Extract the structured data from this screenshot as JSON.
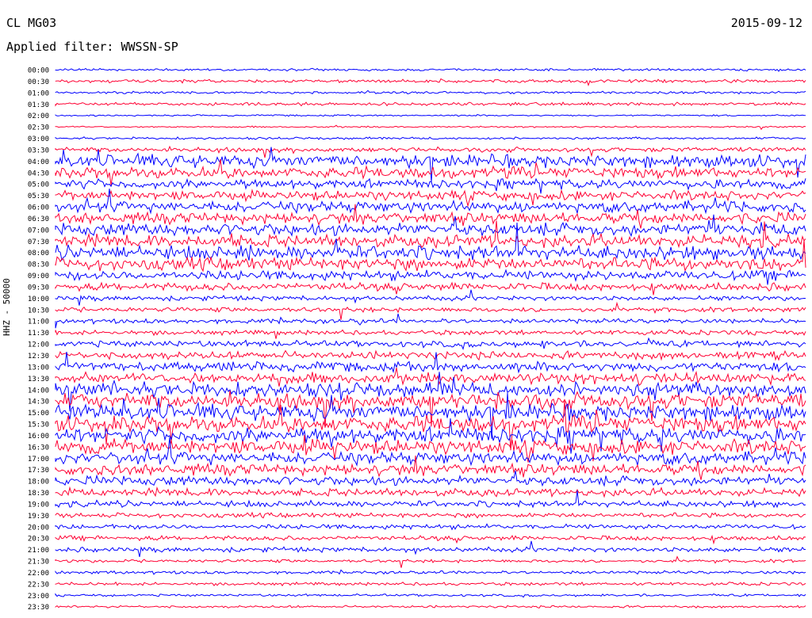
{
  "header": {
    "station": "CL MG03",
    "date": "2015-09-12",
    "filter": "Applied filter: WWSSN-SP"
  },
  "axis": {
    "ylabel": "HHZ - 50000"
  },
  "chart_data": {
    "type": "line",
    "title": "",
    "xlabel": "",
    "ylabel": "HHZ - 50000",
    "trace_colors": [
      "#0000ff",
      "#ff0033"
    ],
    "tick_labels": [
      "00:00",
      "00:30",
      "01:00",
      "01:30",
      "02:00",
      "02:30",
      "03:00",
      "03:30",
      "04:00",
      "04:30",
      "05:00",
      "05:30",
      "06:00",
      "06:30",
      "07:00",
      "07:30",
      "08:00",
      "08:30",
      "09:00",
      "09:30",
      "10:00",
      "10:30",
      "11:00",
      "11:30",
      "12:00",
      "12:30",
      "13:00",
      "13:30",
      "14:00",
      "14:30",
      "15:00",
      "15:30",
      "16:00",
      "16:30",
      "17:00",
      "17:30",
      "18:00",
      "18:30",
      "19:00",
      "19:30",
      "20:00",
      "20:30",
      "21:00",
      "21:30",
      "22:00",
      "22:30",
      "23:00",
      "23:30"
    ],
    "activity_level": [
      0.15,
      0.2,
      0.15,
      0.2,
      0.1,
      0.1,
      0.15,
      0.3,
      0.8,
      0.7,
      0.6,
      0.6,
      0.7,
      0.7,
      0.8,
      0.8,
      0.9,
      0.8,
      0.6,
      0.5,
      0.3,
      0.3,
      0.3,
      0.3,
      0.4,
      0.5,
      0.6,
      0.7,
      0.9,
      1.0,
      1.0,
      1.0,
      1.0,
      0.9,
      0.8,
      0.7,
      0.6,
      0.5,
      0.4,
      0.3,
      0.3,
      0.3,
      0.3,
      0.2,
      0.2,
      0.2,
      0.15,
      0.15
    ]
  }
}
